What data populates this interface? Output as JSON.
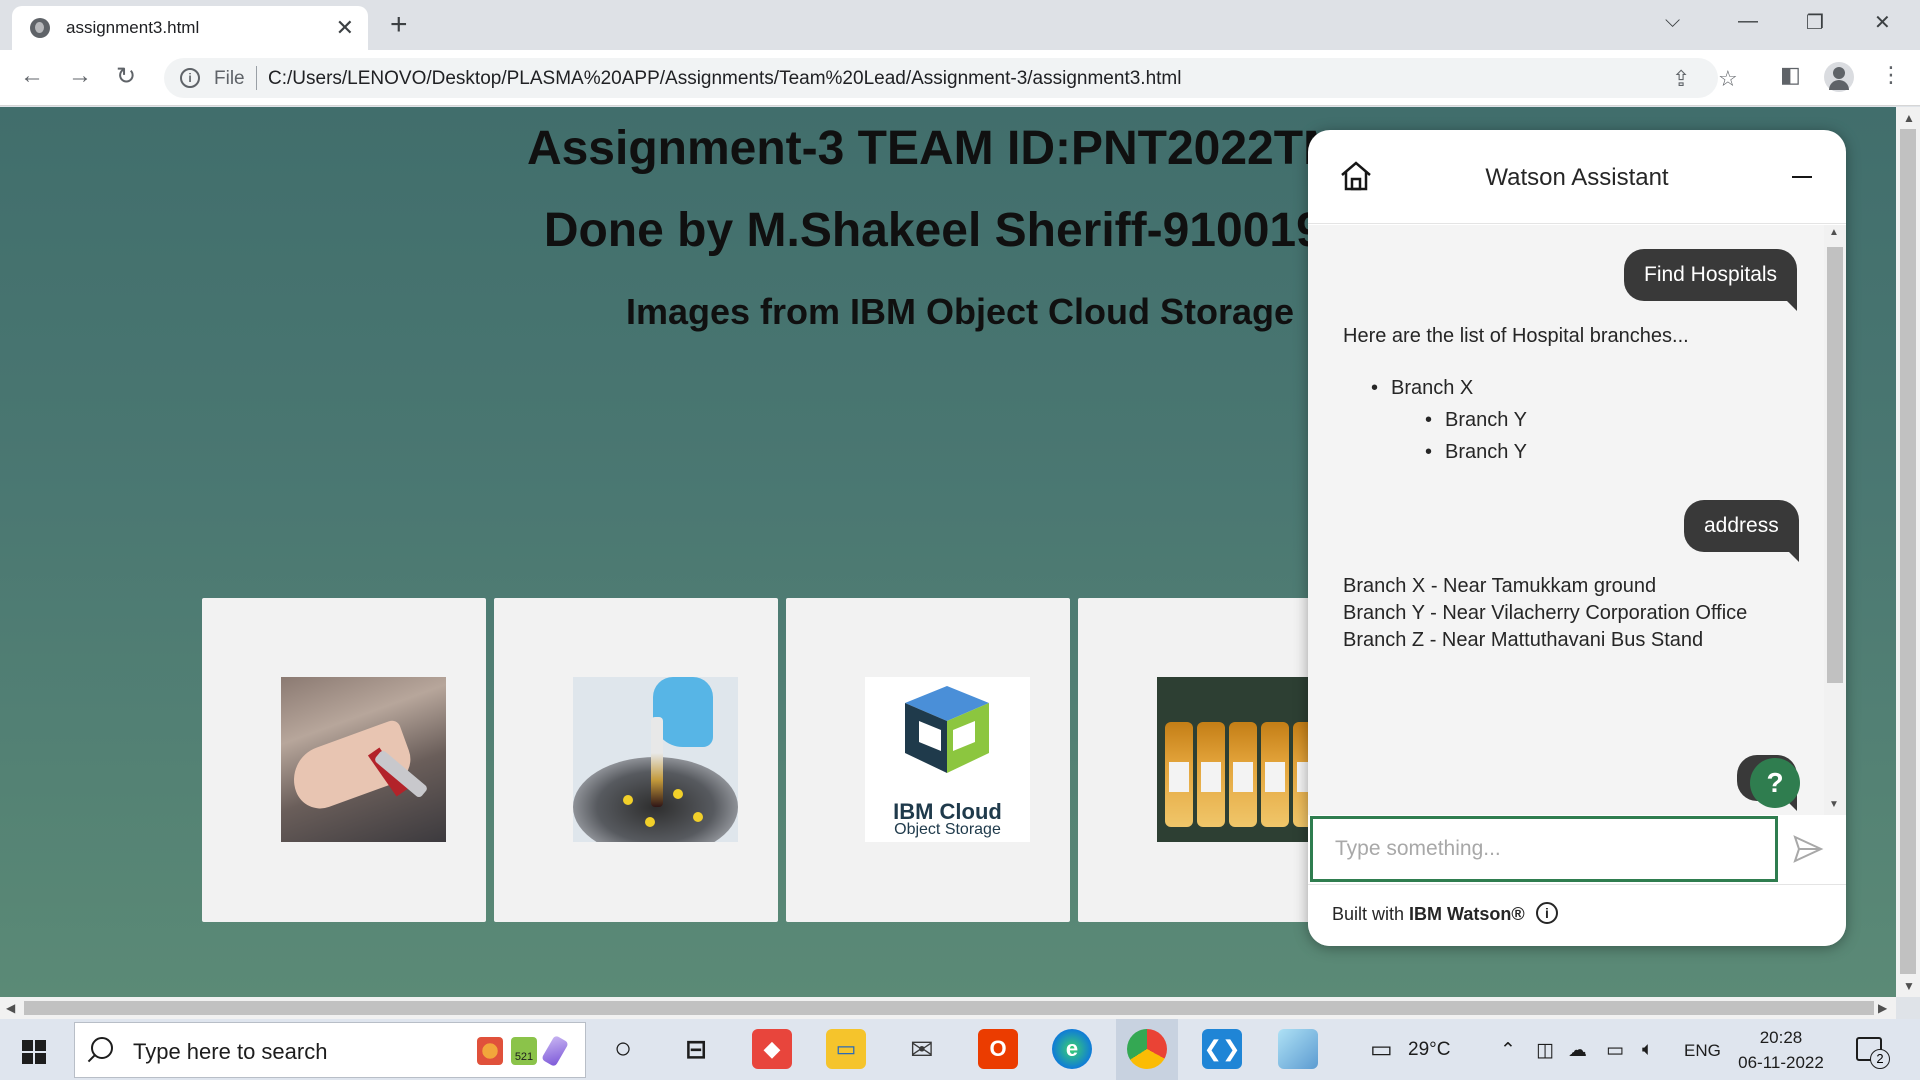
{
  "browser": {
    "tab_title": "assignment3.html",
    "url_scheme": "File",
    "url": "C:/Users/LENOVO/Desktop/PLASMA%20APP/Assignments/Team%20Lead/Assignment-3/assignment3.html"
  },
  "page": {
    "heading1": "Assignment-3 TEAM ID:PNT2022TMID",
    "heading2": "Done by M.Shakeel Sheriff-91001910",
    "heading3": "Images from IBM Object Cloud Storage",
    "ibm_logo_line1": "IBM Cloud",
    "ibm_logo_line2": "Object Storage"
  },
  "assistant": {
    "title": "Watson Assistant",
    "messages": {
      "user1": "Find Hospitals",
      "bot1_intro": "Here are the list of Hospital branches...",
      "bot1_items": [
        "Branch X",
        "Branch Y",
        "Branch Y"
      ],
      "user2": "address",
      "bot2_lines": [
        "Branch X - Near Tamukkam ground",
        "Branch Y - Near Vilacherry Corporation Office",
        "Branch Z - Near Mattuthavani Bus Stand"
      ]
    },
    "help_label": "?",
    "input_placeholder": "Type something...",
    "footer_prefix": "Built with ",
    "footer_brand": "IBM Watson®"
  },
  "taskbar": {
    "search_placeholder": "Type here to search",
    "search_badge": "521",
    "weather": "29°C",
    "language": "ENG",
    "time": "20:28",
    "date": "06-11-2022",
    "notification_count": "2"
  },
  "colors": {
    "page_bg_top": "#416e6c",
    "page_bg_bottom": "#5b8a76",
    "assistant_accent": "#2f7d4f",
    "user_bubble": "#393939"
  }
}
